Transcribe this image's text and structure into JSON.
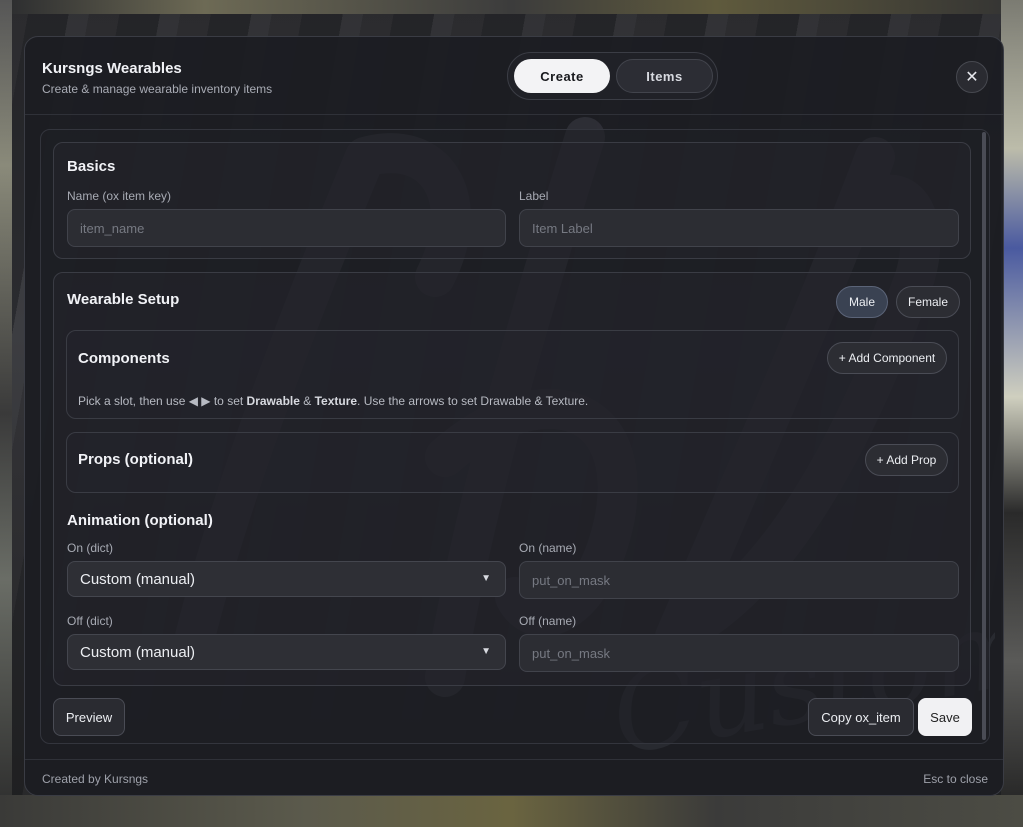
{
  "header": {
    "title": "Kursngs Wearables",
    "subtitle": "Create & manage wearable inventory items",
    "tabs": [
      {
        "label": "Create",
        "active": true
      },
      {
        "label": "Items",
        "active": false
      }
    ],
    "close_icon": "close-icon"
  },
  "basics": {
    "title": "Basics",
    "name_label": "Name (ox item key)",
    "name_placeholder": "item_name",
    "name_value": "",
    "label_label": "Label",
    "label_placeholder": "Item Label",
    "label_value": ""
  },
  "wearable_setup": {
    "title": "Wearable Setup",
    "gender_options": [
      {
        "label": "Male",
        "active": true
      },
      {
        "label": "Female",
        "active": false
      }
    ],
    "components": {
      "title": "Components",
      "add_label": "+ Add Component",
      "hint_pre": "Pick a slot, then use ◀ ▶ to set ",
      "hint_b1": "Drawable",
      "hint_mid": " & ",
      "hint_b2": "Texture",
      "hint_post": ". Use the arrows to set Drawable & Texture."
    },
    "props": {
      "title": "Props (optional)",
      "add_label": "+ Add Prop"
    },
    "animation": {
      "title": "Animation (optional)",
      "on_dict_label": "On (dict)",
      "on_dict_value": "Custom (manual)",
      "on_name_label": "On (name)",
      "on_name_placeholder": "put_on_mask",
      "off_dict_label": "Off (dict)",
      "off_dict_value": "Custom (manual)",
      "off_name_label": "Off (name)",
      "off_name_placeholder": "put_on_mask"
    }
  },
  "actions": {
    "preview_label": "Preview",
    "copy_label": "Copy ox_item",
    "save_label": "Save"
  },
  "footer": {
    "credit": "Created by Kursngs",
    "esc_hint": "Esc to close"
  },
  "watermark_text": "Customs",
  "colors": {
    "accent_active_tab": "#f3f3f5",
    "panel_bg": "#1c1d22",
    "active_pill": "#3a4252"
  }
}
